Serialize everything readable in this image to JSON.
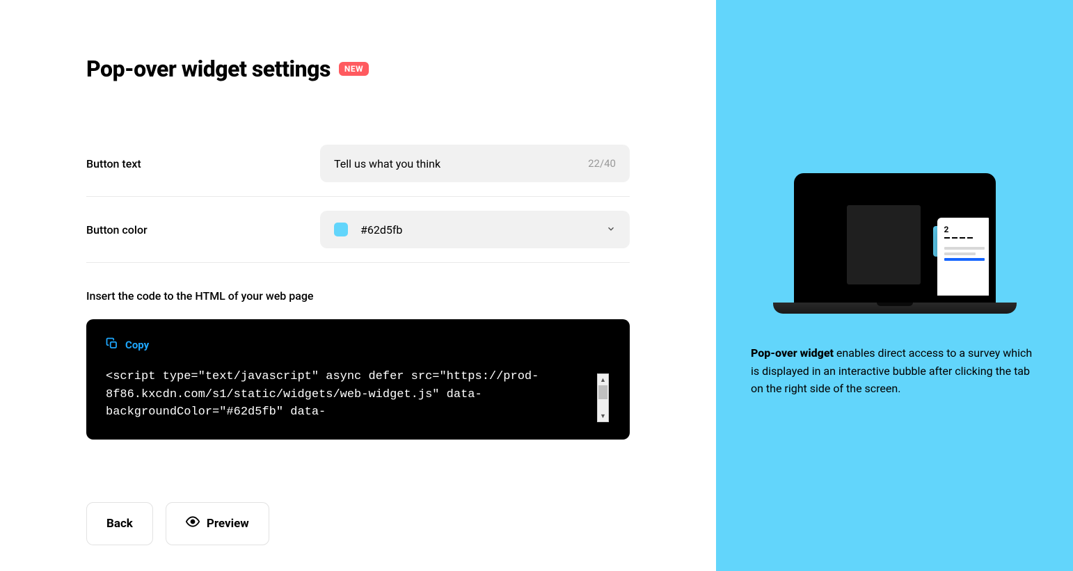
{
  "header": {
    "title": "Pop-over widget settings",
    "badge": "NEW"
  },
  "form": {
    "buttonText": {
      "label": "Button text",
      "value": "Tell us what you think",
      "counter": "22/40"
    },
    "buttonColor": {
      "label": "Button color",
      "value": "#62d5fb",
      "swatchColor": "#62d5fb"
    },
    "insertLabel": "Insert the code to the HTML of your web page"
  },
  "code": {
    "copyLabel": "Copy",
    "snippet": "<script type=\"text/javascript\" async defer src=\"https://prod-8f86.kxcdn.com/s1/static/widgets/web-widget.js\" data-backgroundColor=\"#62d5fb\" data-"
  },
  "actions": {
    "back": "Back",
    "preview": "Preview"
  },
  "side": {
    "popupNumber": "2",
    "bold": "Pop-over widget",
    "desc": " enables direct access to a survey which is displayed in an interactive bubble after clicking the tab on the right side of the screen."
  }
}
